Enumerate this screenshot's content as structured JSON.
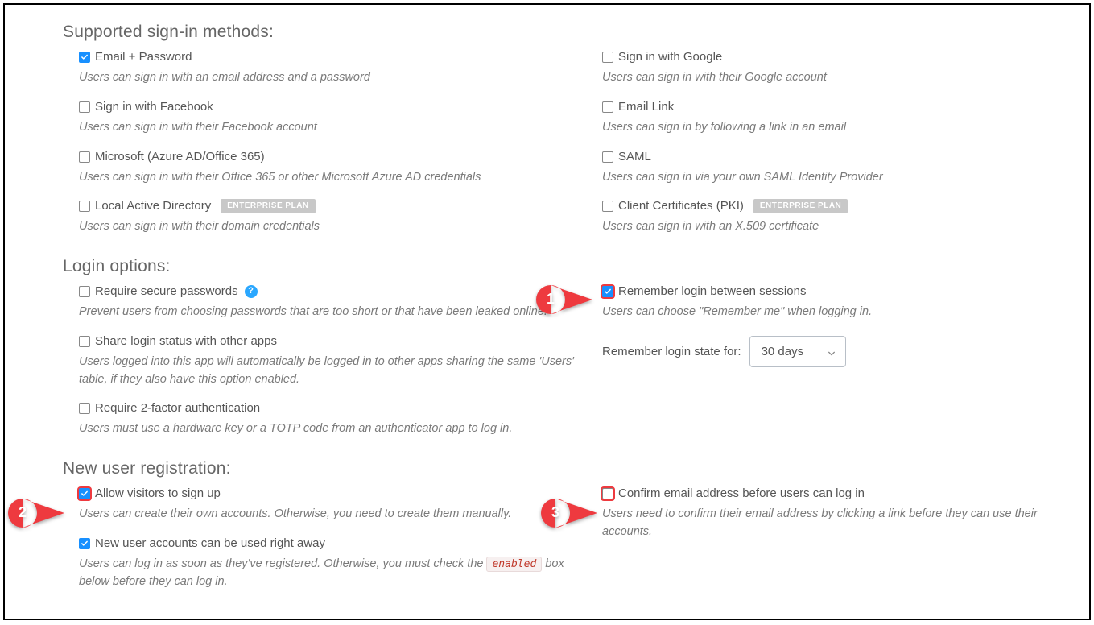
{
  "sections": {
    "signin": {
      "title": "Supported sign-in methods:",
      "items": [
        {
          "label": "Email + Password",
          "desc": "Users can sign in with an email address and a password",
          "checked": true
        },
        {
          "label": "Sign in with Google",
          "desc": "Users can sign in with their Google account",
          "checked": false
        },
        {
          "label": "Sign in with Facebook",
          "desc": "Users can sign in with their Facebook account",
          "checked": false
        },
        {
          "label": "Email Link",
          "desc": "Users can sign in by following a link in an email",
          "checked": false
        },
        {
          "label": "Microsoft (Azure AD/Office 365)",
          "desc": "Users can sign in with their Office 365 or other Microsoft Azure AD credentials",
          "checked": false
        },
        {
          "label": "SAML",
          "desc": "Users can sign in via your own SAML Identity Provider",
          "checked": false
        },
        {
          "label": "Local Active Directory",
          "desc": "Users can sign in with their domain credentials",
          "checked": false,
          "badge": "ENTERPRISE PLAN"
        },
        {
          "label": "Client Certificates (PKI)",
          "desc": "Users can sign in with an X.509 certificate",
          "checked": false,
          "badge": "ENTERPRISE PLAN"
        }
      ]
    },
    "login": {
      "title": "Login options:",
      "left": [
        {
          "label": "Require secure passwords",
          "desc": "Prevent users from choosing passwords that are too short or that have been leaked online.",
          "checked": false,
          "help": "?"
        },
        {
          "label": "Share login status with other apps",
          "desc": "Users logged into this app will automatically be logged in to other apps sharing the same 'Users' table, if they also have this option enabled.",
          "checked": false
        },
        {
          "label": "Require 2-factor authentication",
          "desc": "Users must use a hardware key or a TOTP code from an authenticator app to log in.",
          "checked": false
        }
      ],
      "right": {
        "remember_label": "Remember login between sessions",
        "remember_desc": "Users can choose \"Remember me\" when logging in.",
        "remember_checked": true,
        "duration_label": "Remember login state for:",
        "duration_value": "30 days"
      }
    },
    "newuser": {
      "title": "New user registration:",
      "left": [
        {
          "label": "Allow visitors to sign up",
          "desc": "Users can create their own accounts. Otherwise, you need to create them manually.",
          "checked": true
        },
        {
          "label": "New user accounts can be used right away",
          "desc_pre": "Users can log in as soon as they've registered. Otherwise, you must check the ",
          "code": "enabled",
          "desc_post": " box below before they can log in.",
          "checked": true
        }
      ],
      "right": {
        "confirm_label": "Confirm email address before users can log in",
        "confirm_desc": "Users need to confirm their email address by clicking a link before they can use their accounts.",
        "confirm_checked": false
      }
    }
  },
  "annotations": {
    "pin1": "1",
    "pin2": "2",
    "pin3": "3"
  }
}
